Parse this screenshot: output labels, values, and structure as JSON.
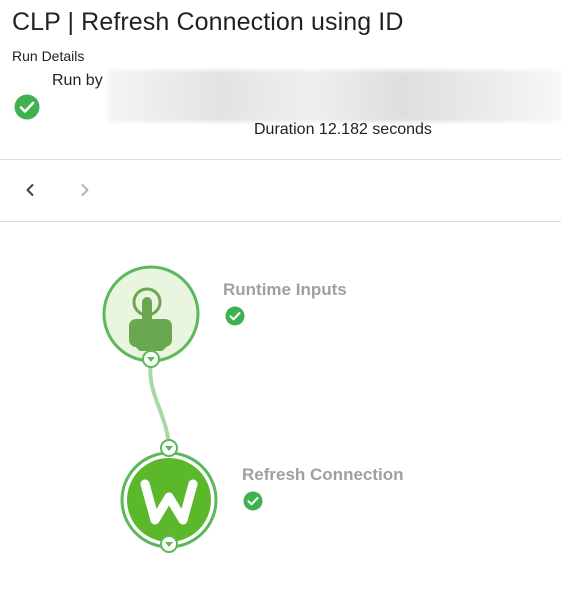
{
  "header": {
    "title": "CLP | Refresh Connection using ID",
    "subtitle": "Run Details",
    "run_by_label": "Run by",
    "duration": "Duration 12.182 seconds"
  },
  "navigation": {
    "previous_icon": "chevron-left-icon",
    "next_icon": "chevron-right-icon"
  },
  "flow": {
    "nodes": [
      {
        "label": "Runtime Inputs",
        "icon": "pointing-hand-icon",
        "status": "success"
      },
      {
        "label": "Refresh Connection",
        "icon": "workato-w-logo-icon",
        "status": "success"
      }
    ]
  },
  "colors": {
    "success_green": "#3fb24f",
    "node_ring_green": "#5cb85c",
    "node_fill_light": "#eaf5e0",
    "hand_green": "#6aa84f",
    "logo_green": "#5cb82b",
    "connector_green": "#a9d8a6",
    "label_grey": "#a0a0a0"
  }
}
